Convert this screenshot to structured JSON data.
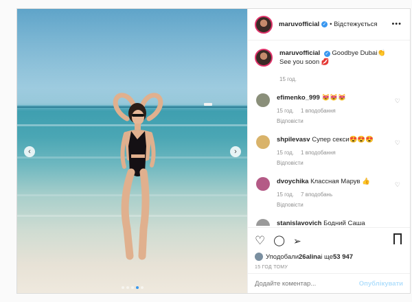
{
  "header": {
    "handle": "maruvofficial",
    "verified_mark": "✓",
    "following": "• Відстежується",
    "more": "•••"
  },
  "photo": {
    "prev": "‹",
    "next": "›",
    "dots": 5,
    "active_dot": 3
  },
  "caption": {
    "handle": "maruvofficial",
    "text1": "Goodbye Dubai👏",
    "text2": "See you soon 💋",
    "time": "15 год."
  },
  "comments": [
    {
      "handle": "efimenko_999",
      "text": "😻😻😻",
      "time": "15 год.",
      "likes": "1 вподобання",
      "reply": "Відповісти",
      "avatar_color": "#8a8f7a"
    },
    {
      "handle": "shpilevasv",
      "text": "Супер секси😍😍😍",
      "time": "15 год.",
      "likes": "1 вподобання",
      "reply": "Відповісти",
      "avatar_color": "#d9b36a"
    },
    {
      "handle": "dvoychika",
      "text": "Классная Марув 👍",
      "time": "15 год.",
      "likes": "7 вподобань",
      "reply": "Відповісти",
      "avatar_color": "#b45a86"
    },
    {
      "handle": "stanislavovich",
      "text": "Бодний Саша",
      "time": "",
      "likes": "",
      "reply": "",
      "avatar_color": "#9a9a9a"
    }
  ],
  "actions": {
    "heart": "♡",
    "comment": "◯",
    "share": "➢",
    "liked_by_prefix": "Уподобали ",
    "liked_by_user": "26alina",
    "liked_by_suffix": " і ще ",
    "like_count": "53 947",
    "time_ago": "15 ГОД ТОМУ"
  },
  "add_comment": {
    "placeholder": "Додайте коментар...",
    "post_label": "Опублікувати"
  },
  "colors": {
    "accent": "#3897f0",
    "post_disabled": "#b2dffc",
    "muted": "#8e8e8e"
  }
}
